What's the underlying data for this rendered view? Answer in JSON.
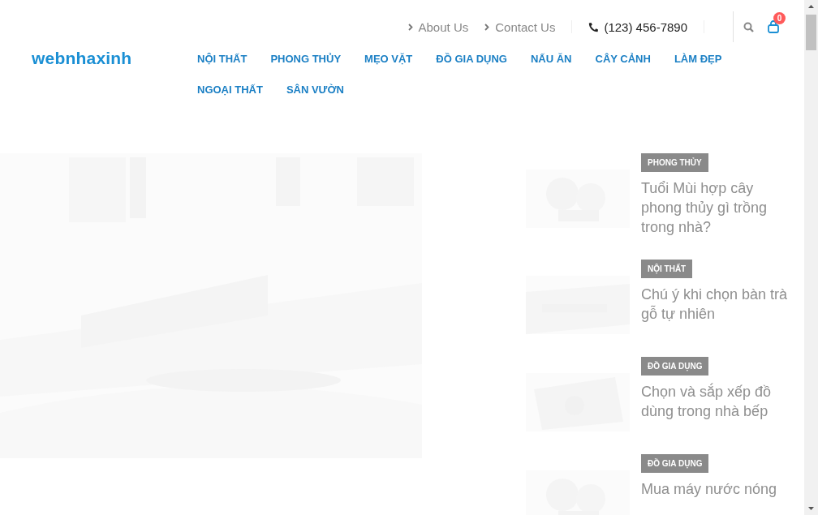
{
  "logo": "webnhaxinh",
  "top_links": [
    {
      "label": "About Us"
    },
    {
      "label": "Contact Us"
    }
  ],
  "phone": "(123) 456-7890",
  "cart": {
    "count": "0"
  },
  "nav": [
    {
      "label": "NỘI THẤT"
    },
    {
      "label": "PHONG THỦY"
    },
    {
      "label": "MẸO VẶT"
    },
    {
      "label": "ĐỒ GIA DỤNG"
    },
    {
      "label": "NẤU ĂN"
    },
    {
      "label": "CÂY CẢNH"
    },
    {
      "label": "LÀM ĐẸP"
    },
    {
      "label": "NGOẠI THẤT"
    },
    {
      "label": "SÂN VƯỜN"
    }
  ],
  "posts": [
    {
      "category": "PHONG THỦY",
      "title": "Tuổi Mùi hợp cây phong thủy gì trồng trong nhà?"
    },
    {
      "category": "NỘI THẤT",
      "title": "Chú ý khi chọn bàn trà gỗ tự nhiên"
    },
    {
      "category": "ĐỒ GIA DỤNG",
      "title": "Chọn và sắp xếp đồ dùng trong nhà bếp"
    },
    {
      "category": "ĐỒ GIA DỤNG",
      "title": "Mua máy nước nóng"
    }
  ]
}
